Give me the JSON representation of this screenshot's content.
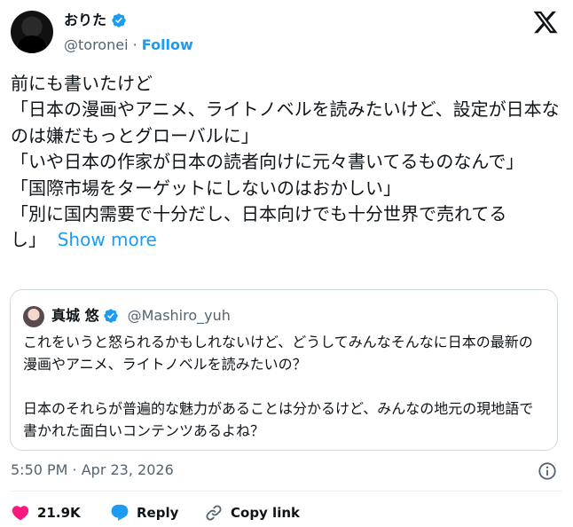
{
  "colors": {
    "accent": "#1d9bf0",
    "like": "#f91880",
    "text": "#0f1419",
    "secondary": "#536471"
  },
  "author": {
    "name": "おりた",
    "handle": "@toronei",
    "separator": "·",
    "follow_label": "Follow",
    "verified_icon": "verified-badge-icon"
  },
  "tweet": {
    "text": "前にも書いたけど\n「日本の漫画やアニメ、ライトノベルを読みたいけど、設定が日本なのは嫌だもっとグローバルに」\n「いや日本の作家が日本の読者向けに元々書いてるものなんで」\n「国際市場をターゲットにしないのはおかしい」\n「別に国内需要で十分だし、日本向けでも十分世界で売れてるし」",
    "show_more": "Show more"
  },
  "quote": {
    "name": "真城 悠",
    "handle": "@Mashiro_yuh",
    "text": "これをいうと怒られるかもしれないけど、どうしてみんなそんなに日本の最新の漫画やアニメ、ライトノベルを読みたいの？\n\n日本のそれらが普遍的な魅力があることは分かるけど、みんなの地元の現地語で書かれた面白いコンテンツあるよね？"
  },
  "timestamp": "5:50 PM · Apr 23, 2026",
  "actions": {
    "likes": "21.9K",
    "reply_label": "Reply",
    "copy_label": "Copy link"
  }
}
